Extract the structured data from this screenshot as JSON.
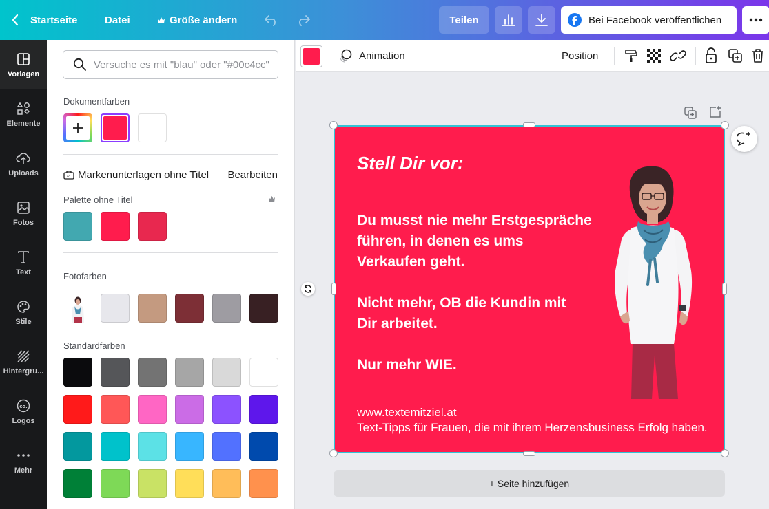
{
  "header": {
    "home_label": "Startseite",
    "file_label": "Datei",
    "resize_label": "Größe ändern",
    "share_label": "Teilen",
    "publish_label": "Bei Facebook veröffentlichen"
  },
  "rail": [
    {
      "label": "Vorlagen",
      "icon": "templates-icon"
    },
    {
      "label": "Elemente",
      "icon": "elements-icon"
    },
    {
      "label": "Uploads",
      "icon": "upload-icon"
    },
    {
      "label": "Fotos",
      "icon": "photos-icon"
    },
    {
      "label": "Text",
      "icon": "text-icon"
    },
    {
      "label": "Stile",
      "icon": "styles-icon"
    },
    {
      "label": "Hintergru...",
      "icon": "background-icon"
    },
    {
      "label": "Logos",
      "icon": "logos-icon"
    },
    {
      "label": "Mehr",
      "icon": "more-icon"
    }
  ],
  "panel": {
    "search_placeholder": "Versuche es mit \"blau\" oder \"#00c4cc\"",
    "document_colors_title": "Dokumentfarben",
    "document_colors": [
      "#ff1c4d",
      "#ffffff"
    ],
    "brand_kit_label": "Markenunterlagen ohne Titel",
    "brand_edit_label": "Bearbeiten",
    "palette_title": "Palette ohne Titel",
    "palette_colors": [
      "#42a8b0",
      "#ff1c4d",
      "#e8284f"
    ],
    "photo_colors_title": "Fotofarben",
    "photo_colors": [
      "#e7e7ec",
      "#c49a80",
      "#7d2f36",
      "#9e9ca2",
      "#382023"
    ],
    "standard_colors_title": "Standardfarben",
    "standard_colors": [
      [
        "#0b0b0d",
        "#555659",
        "#737373",
        "#a6a6a6",
        "#d9d9d9",
        "#ffffff"
      ],
      [
        "#ff1a1a",
        "#ff5757",
        "#ff66c4",
        "#cb6ce6",
        "#8c52ff",
        "#5e17eb"
      ],
      [
        "#03989e",
        "#00c2cb",
        "#5ce1e6",
        "#38b6ff",
        "#5271ff",
        "#004aad"
      ],
      [
        "#008037",
        "#7ed957",
        "#c9e265",
        "#ffde59",
        "#ffbd59",
        "#ff914d"
      ]
    ]
  },
  "toolbar": {
    "current_color": "#ff1c4d",
    "animation_label": "Animation",
    "position_label": "Position"
  },
  "design": {
    "background": "#ff1c4d",
    "headline": "Stell Dir vor:",
    "line1": "Du musst nie mehr Erstgespräche",
    "line2": "führen, in denen es ums",
    "line3": "Verkaufen geht.",
    "line4": "Nicht mehr, OB die Kundin mit",
    "line5": "Dir arbeitet.",
    "line6": "Nur mehr WIE.",
    "website": "www.textemitziel.at",
    "tagline": "Text-Tipps für Frauen, die mit ihrem Herzensbusiness Erfolg haben."
  },
  "add_page_label": "+ Seite hinzufügen"
}
